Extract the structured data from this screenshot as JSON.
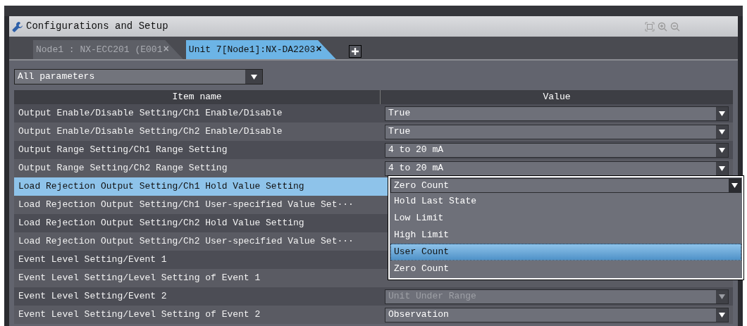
{
  "window": {
    "title": "Configurations and Setup"
  },
  "tabs": [
    {
      "label": "Node1 : NX-ECC201 (E001",
      "selected": false,
      "close": "×"
    },
    {
      "label": "Unit 7[Node1]:NX-DA2203",
      "selected": true,
      "close": "×"
    }
  ],
  "filter": {
    "value": "All parameters"
  },
  "table": {
    "columns": [
      "Item name",
      "Value"
    ],
    "rows": [
      {
        "name": "Output Enable/Disable Setting/Ch1 Enable/Disable",
        "value": "True",
        "selected": false,
        "disabled": false
      },
      {
        "name": "Output Enable/Disable Setting/Ch2 Enable/Disable",
        "value": "True",
        "selected": false,
        "disabled": false
      },
      {
        "name": "Output Range Setting/Ch1 Range Setting",
        "value": "4 to 20 mA",
        "selected": false,
        "disabled": false
      },
      {
        "name": "Output Range Setting/Ch2 Range Setting",
        "value": "4 to 20 mA",
        "selected": false,
        "disabled": false
      },
      {
        "name": "Load Rejection Output Setting/Ch1 Hold Value Setting",
        "value": "Zero Count",
        "selected": true
      },
      {
        "name": "Load Rejection Output Setting/Ch1 User-specified Value Set···",
        "selected": false
      },
      {
        "name": "Load Rejection Output Setting/Ch2 Hold Value Setting",
        "selected": false
      },
      {
        "name": "Load Rejection Output Setting/Ch2 User-specified Value Set···",
        "selected": false
      },
      {
        "name": "Event Level Setting/Event 1",
        "selected": false
      },
      {
        "name": "Event Level Setting/Level Setting of Event 1",
        "selected": false
      },
      {
        "name": "Event Level Setting/Event 2",
        "value": "Unit Under Range",
        "selected": false,
        "disabled": true
      },
      {
        "name": "Event Level Setting/Level Setting of Event 2",
        "value": "Observation",
        "selected": false,
        "disabled": false
      }
    ]
  },
  "dropdown": {
    "options": [
      {
        "label": "Hold Last State",
        "selected": false
      },
      {
        "label": "Low Limit",
        "selected": false
      },
      {
        "label": "High Limit",
        "selected": false
      },
      {
        "label": "User Count",
        "selected": true
      },
      {
        "label": "Zero Count",
        "selected": false
      }
    ]
  }
}
